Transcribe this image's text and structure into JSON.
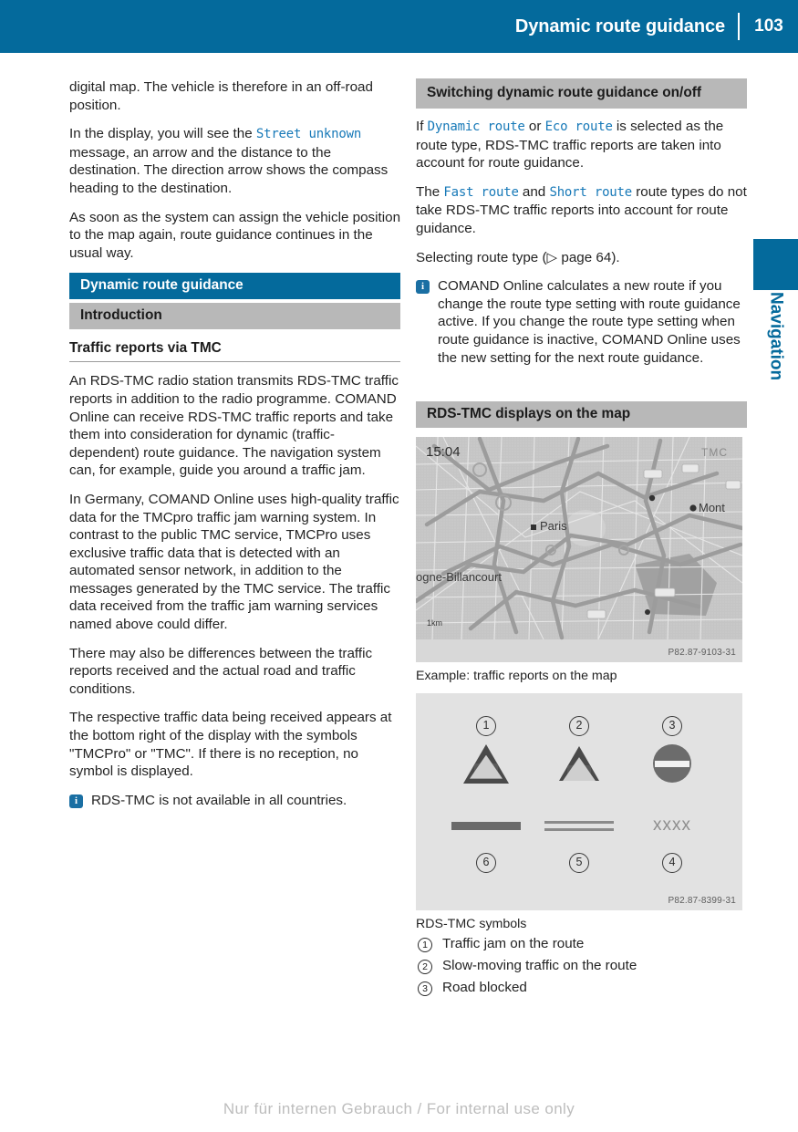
{
  "header": {
    "title": "Dynamic route guidance",
    "page_number": "103"
  },
  "side_tab": {
    "label": "Navigation"
  },
  "left_column": {
    "para_1": "digital map. The vehicle is therefore in an off-road position.",
    "para_2_pre": "In the display, you will see the ",
    "para_2_mono": "Street unknown",
    "para_2_post": " message, an arrow and the distance to the destination. The direction arrow shows the compass heading to the destination.",
    "para_3": "As soon as the system can assign the vehicle position to the map again, route guidance continues in the usual way.",
    "section_bar": "Dynamic route guidance",
    "subsection_bar": "Introduction",
    "heading_tmc": "Traffic reports via TMC",
    "para_4": "An RDS-TMC radio station transmits RDS-TMC traffic reports in addition to the radio programme. COMAND Online can receive RDS-TMC traffic reports and take them into consideration for dynamic (traffic-dependent) route guidance. The navigation system can, for example, guide you around a traffic jam.",
    "para_5": "In Germany, COMAND Online uses high-quality traffic data for the TMCpro traffic jam warning system. In contrast to the public TMC service, TMCPro uses exclusive traffic data that is detected with an automated sensor network, in addition to the messages generated by the TMC service. The traffic data received from the traffic jam warning services named above could differ.",
    "para_6": "There may also be differences between the traffic reports received and the actual road and traffic conditions.",
    "para_7": "The respective traffic data being received appears at the bottom right of the display with the symbols \"TMCPro\" or \"TMC\". If there is no reception, no symbol is displayed.",
    "note_1": {
      "icon": "info-icon",
      "text": "RDS-TMC is not available in all countries."
    }
  },
  "right_column": {
    "section_bar": "Switching dynamic route guidance on/off",
    "para_1_a": "If ",
    "para_1_mono_1": "Dynamic route",
    "para_1_b": " or ",
    "para_1_mono_2": "Eco route",
    "para_1_c": " is selected as the route type, RDS-TMC traffic reports are taken into account for route guidance.",
    "para_2_a": "The ",
    "para_2_mono_1": "Fast route",
    "para_2_b": " and ",
    "para_2_mono_2": "Short route",
    "para_2_c": " route types do not take RDS-TMC traffic reports into account for route guidance.",
    "para_3": "Selecting route type (▷ page 64).",
    "note_1": {
      "icon": "info-icon",
      "text": "COMAND Online calculates a new route if you change the route type setting with route guidance active. If you change the route type setting when route guidance is inactive, COMAND Online uses the new setting for the next route guidance."
    },
    "section_bar_2": "RDS-TMC displays on the map",
    "map_figure": {
      "clock": "15:04",
      "tmc_badge": "TMC",
      "scale": "1km",
      "city_paris": "Paris",
      "city_mont": "Mont",
      "city_billancourt": "ogne-Billancourt",
      "image_code": "P82.87-9103-31",
      "caption": "Example: traffic reports on the map"
    },
    "symbols_figure": {
      "image_code": "P82.87-8399-31",
      "callouts_top": [
        "1",
        "2",
        "3"
      ],
      "callouts_bottom": [
        "6",
        "5",
        "4"
      ],
      "xxxx_label": "xxxx"
    },
    "legend_title": "RDS-TMC symbols",
    "legend_items": [
      {
        "num": "1",
        "text": "Traffic jam on the route"
      },
      {
        "num": "2",
        "text": "Slow-moving traffic on the route"
      },
      {
        "num": "3",
        "text": "Road blocked"
      }
    ]
  },
  "footer": {
    "watermark": "Nur für internen Gebrauch / For internal use only"
  },
  "colors": {
    "brand_blue": "#046a9c",
    "mono_blue": "#1779b8",
    "grey_bar": "#b8b8b8"
  }
}
